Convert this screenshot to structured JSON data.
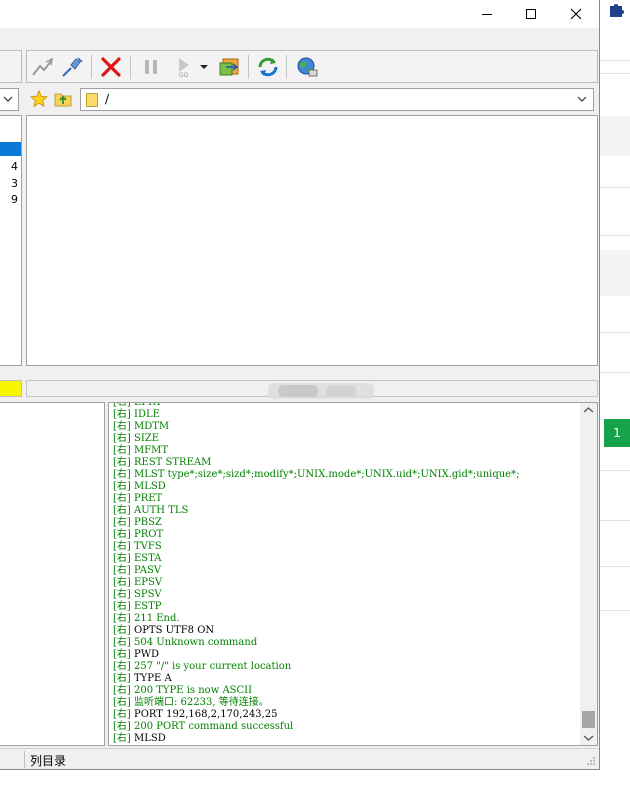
{
  "window": {
    "controls": {
      "minimize": "minimize-icon",
      "maximize": "maximize-icon",
      "close": "close-icon"
    }
  },
  "toolbar": {
    "icons": [
      "connect-icon",
      "disconnect-icon",
      "abort-icon",
      "pause-icon",
      "go-icon",
      "go-dropdown-icon",
      "transfer-icon",
      "refresh-icon",
      "site-manager-icon"
    ]
  },
  "address": {
    "path": "/"
  },
  "left_pane": {
    "numbers": [
      "4",
      "3",
      "9"
    ]
  },
  "log": {
    "lines": [
      {
        "prefix": "[右]",
        "text": " EPRT",
        "color": "green"
      },
      {
        "prefix": "[右]",
        "text": " IDLE",
        "color": "green"
      },
      {
        "prefix": "[右]",
        "text": " MDTM",
        "color": "green"
      },
      {
        "prefix": "[右]",
        "text": " SIZE",
        "color": "green"
      },
      {
        "prefix": "[右]",
        "text": " MFMT",
        "color": "green"
      },
      {
        "prefix": "[右]",
        "text": " REST STREAM",
        "color": "green"
      },
      {
        "prefix": "[右]",
        "text": " MLST type*;size*;sizd*;modify*;UNIX.mode*;UNIX.uid*;UNIX.gid*;unique*;",
        "color": "green"
      },
      {
        "prefix": "[右]",
        "text": " MLSD",
        "color": "green"
      },
      {
        "prefix": "[右]",
        "text": " PRET",
        "color": "green"
      },
      {
        "prefix": "[右]",
        "text": " AUTH TLS",
        "color": "green"
      },
      {
        "prefix": "[右]",
        "text": " PBSZ",
        "color": "green"
      },
      {
        "prefix": "[右]",
        "text": " PROT",
        "color": "green"
      },
      {
        "prefix": "[右]",
        "text": " TVFS",
        "color": "green"
      },
      {
        "prefix": "[右]",
        "text": " ESTA",
        "color": "green"
      },
      {
        "prefix": "[右]",
        "text": " PASV",
        "color": "green"
      },
      {
        "prefix": "[右]",
        "text": " EPSV",
        "color": "green"
      },
      {
        "prefix": "[右]",
        "text": " SPSV",
        "color": "green"
      },
      {
        "prefix": "[右]",
        "text": " ESTP",
        "color": "green"
      },
      {
        "prefix": "[右]",
        "text": " 211 End.",
        "color": "green"
      },
      {
        "prefix": "[右]",
        "text": " OPTS UTF8 ON",
        "color": "black"
      },
      {
        "prefix": "[右]",
        "text": " 504 Unknown command",
        "color": "green"
      },
      {
        "prefix": "[右]",
        "text": " PWD",
        "color": "black"
      },
      {
        "prefix": "[右]",
        "text": " 257 \"/\" is your current location",
        "color": "green"
      },
      {
        "prefix": "[右]",
        "text": " TYPE A",
        "color": "black"
      },
      {
        "prefix": "[右]",
        "text": " 200 TYPE is now ASCII",
        "color": "green"
      },
      {
        "prefix": "[右]",
        "text": " 监听端口: 62233, 等待连接。",
        "color": "green"
      },
      {
        "prefix": "[右]",
        "text": " PORT 192,168,2,170,243,25",
        "color": "black"
      },
      {
        "prefix": "[右]",
        "text": " 200 PORT command successful",
        "color": "green"
      },
      {
        "prefix": "[右]",
        "text": " MLSD",
        "color": "black"
      }
    ]
  },
  "statusbar": {
    "text": "列目录"
  },
  "background": {
    "badge": "1"
  },
  "colors": {
    "log_green": "#008000",
    "selection": "#0a7ad8",
    "left_status": "#f7f500",
    "badge_green": "#15a34a"
  }
}
